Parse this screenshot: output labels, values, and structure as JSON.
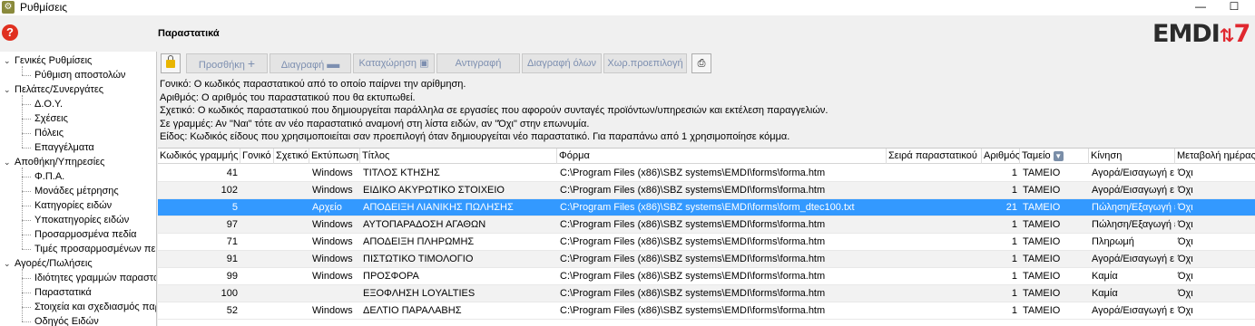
{
  "window": {
    "title": "Ρυθμίσεις",
    "minimize_glyph": "—",
    "maximize_glyph": "☐"
  },
  "help": {
    "glyph": "?"
  },
  "page_title": "Παραστατικά",
  "logo": {
    "text": "EMDI",
    "arrows": "⇅",
    "number": "7"
  },
  "tree": {
    "groups": [
      {
        "label": "Γενικές Ρυθμίσεις",
        "items": [
          "Ρύθμιση αποστολών"
        ]
      },
      {
        "label": "Πελάτες/Συνεργάτες",
        "items": [
          "Δ.Ο.Υ.",
          "Σχέσεις",
          "Πόλεις",
          "Επαγγέλματα"
        ]
      },
      {
        "label": "Αποθήκη/Υπηρεσίες",
        "items": [
          "Φ.Π.Α.",
          "Μονάδες μέτρησης",
          "Κατηγορίες ειδών",
          "Υποκατηγορίες ειδών",
          "Προσαρμοσμένα πεδία",
          "Τιμές προσαρμοσμένων πε"
        ]
      },
      {
        "label": "Αγορές/Πωλήσεις",
        "items": [
          "Ιδιότητες γραμμών παραστα",
          "Παραστατικά",
          "Στοιχεία και σχεδιασμός παρ",
          "Οδηγός Ειδών"
        ]
      }
    ]
  },
  "toolbar": {
    "add": "Προσθήκη",
    "delete": "Διαγραφή",
    "save": "Καταχώρηση",
    "copy": "Αντιγραφή",
    "delete_all": "Διαγραφή όλων",
    "default_printer": "Χωρ.προεπιλογή"
  },
  "info_lines": [
    "Γονικό: Ο κωδικός παραστατικού από το οποίο παίρνει την αρίθμηση.",
    "Αριθμός: Ο αριθμός του παραστατικού που θα εκτυπωθεί.",
    "Σχετικό: Ο κωδικός παραστατικού που δημιουργείται παράλληλα σε εργασίες που αφορούν συνταγές προϊόντων/υπηρεσιών και εκτέλεση παραγγελιών.",
    "Σε γραμμές: Αν \"Ναι\" τότε αν νέο παραστατικό αναμονή στη λίστα ειδών, αν \"Όχι\" στην επωνυμία.",
    "Είδος: Κωδικός είδους που χρησιμοποιείται σαν προεπιλογή όταν δημιουργείται νέο παραστατικό. Για παραπάνω από 1 χρησιμοποίησε κόμμα."
  ],
  "grid": {
    "columns": [
      "Κωδικός γραμμής",
      "Γονικό",
      "Σχετικό",
      "Εκτύπωση",
      "Τίτλος",
      "Φόρμα",
      "Σειρά παραστατικού",
      "Αριθμός",
      "Ταμείο",
      "Κίνηση",
      "Μεταβολή ημέρας"
    ],
    "rows": [
      {
        "code": "41",
        "parent": "",
        "related": "",
        "print": "Windows",
        "title": "ΤΙΤΛΟΣ ΚΤΗΣΗΣ",
        "form": "C:\\Program Files (x86)\\SBZ systems\\EMDI\\forms\\forma.htm",
        "series": "",
        "number": "1",
        "cash": "ΤΑΜΕΙΟ",
        "movement": "Αγορά/Εισαγωγή ε",
        "day_change": "Όχι"
      },
      {
        "code": "102",
        "parent": "",
        "related": "",
        "print": "Windows",
        "title": "ΕΙΔΙΚΟ ΑΚΥΡΩΤΙΚΟ ΣΤΟΙΧΕΙΟ",
        "form": "C:\\Program Files (x86)\\SBZ systems\\EMDI\\forms\\forma.htm",
        "series": "",
        "number": "1",
        "cash": "ΤΑΜΕΙΟ",
        "movement": "Αγορά/Εισαγωγή ε",
        "day_change": "Όχι"
      },
      {
        "code": "5",
        "parent": "",
        "related": "",
        "print": "Αρχείο",
        "title": "ΑΠΟΔΕΙΞΗ ΛΙΑΝΙΚΗΣ ΠΩΛΗΣΗΣ",
        "form": "C:\\Program Files (x86)\\SBZ systems\\EMDI\\forms\\form_dtec100.txt",
        "series": "",
        "number": "21",
        "cash": "ΤΑΜΕΙΟ",
        "movement": "Πώληση/Εξαγωγή ε",
        "day_change": "Όχι"
      },
      {
        "code": "97",
        "parent": "",
        "related": "",
        "print": "Windows",
        "title": "ΑΥΤΟΠΑΡΑΔΟΣΗ ΑΓΑΘΩΝ",
        "form": "C:\\Program Files (x86)\\SBZ systems\\EMDI\\forms\\forma.htm",
        "series": "",
        "number": "1",
        "cash": "ΤΑΜΕΙΟ",
        "movement": "Πώληση/Εξαγωγή ε",
        "day_change": "Όχι"
      },
      {
        "code": "71",
        "parent": "",
        "related": "",
        "print": "Windows",
        "title": "ΑΠΟΔΕΙΞΗ ΠΛΗΡΩΜΗΣ",
        "form": "C:\\Program Files (x86)\\SBZ systems\\EMDI\\forms\\forma.htm",
        "series": "",
        "number": "1",
        "cash": "ΤΑΜΕΙΟ",
        "movement": "Πληρωμή",
        "day_change": "Όχι"
      },
      {
        "code": "91",
        "parent": "",
        "related": "",
        "print": "Windows",
        "title": "ΠΙΣΤΩΤΙΚΟ ΤΙΜΟΛΟΓΙΟ",
        "form": "C:\\Program Files (x86)\\SBZ systems\\EMDI\\forms\\forma.htm",
        "series": "",
        "number": "1",
        "cash": "ΤΑΜΕΙΟ",
        "movement": "Αγορά/Εισαγωγή ε",
        "day_change": "Όχι"
      },
      {
        "code": "99",
        "parent": "",
        "related": "",
        "print": "Windows",
        "title": "ΠΡΟΣΦΟΡΑ",
        "form": "C:\\Program Files (x86)\\SBZ systems\\EMDI\\forms\\forma.htm",
        "series": "",
        "number": "1",
        "cash": "ΤΑΜΕΙΟ",
        "movement": "Καμία",
        "day_change": "Όχι"
      },
      {
        "code": "100",
        "parent": "",
        "related": "",
        "print": "",
        "title": "ΕΞΟΦΛΗΣΗ LOYALTIES",
        "form": "C:\\Program Files (x86)\\SBZ systems\\EMDI\\forms\\forma.htm",
        "series": "",
        "number": "1",
        "cash": "ΤΑΜΕΙΟ",
        "movement": "Καμία",
        "day_change": "Όχι"
      },
      {
        "code": "52",
        "parent": "",
        "related": "",
        "print": "Windows",
        "title": "ΔΕΛΤΙΟ ΠΑΡΑΛΑΒΗΣ",
        "form": "C:\\Program Files (x86)\\SBZ systems\\EMDI\\forms\\forma.htm",
        "series": "",
        "number": "1",
        "cash": "ΤΑΜΕΙΟ",
        "movement": "Αγορά/Εισαγωγή ε",
        "day_change": "Όχι"
      }
    ]
  }
}
